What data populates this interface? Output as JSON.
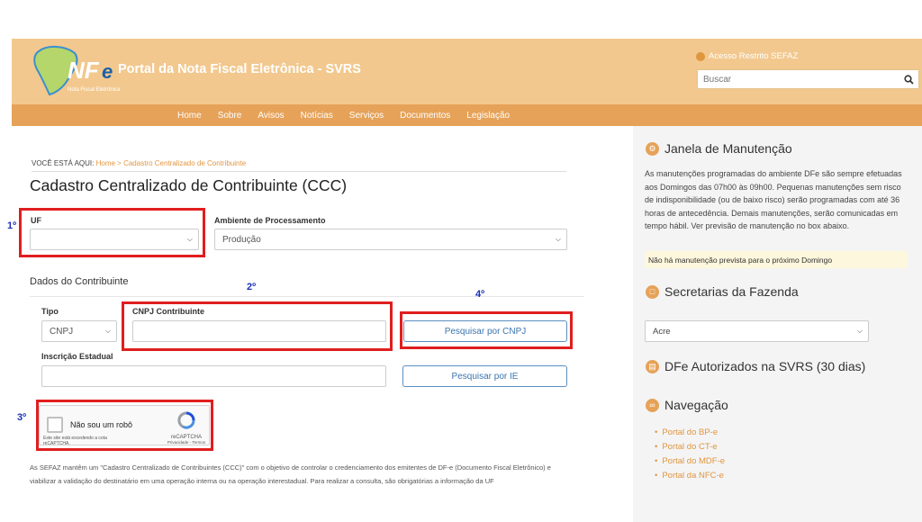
{
  "header": {
    "logo_text": "NF-e",
    "logo_sub": "Nota Fiscal Eletrônica",
    "portal_title": "Portal da Nota Fiscal Eletrônica - SVRS",
    "restricted_access": "Acesso Restrito SEFAZ",
    "search_placeholder": "Buscar"
  },
  "nav": [
    "Home",
    "Sobre",
    "Avisos",
    "Notícias",
    "Serviços",
    "Documentos",
    "Legislação"
  ],
  "breadcrumb": {
    "prefix": "VOCÊ ESTÁ AQUI:",
    "home": "Home",
    "separator": ">",
    "current": "Cadastro Centralizado de Contribuinte"
  },
  "page_title": "Cadastro Centralizado de Contribuinte (CCC)",
  "form": {
    "uf_label": "UF",
    "uf_value": "",
    "ambiente_label": "Ambiente de Processamento",
    "ambiente_value": "Produção",
    "section_title": "Dados do Contribuinte",
    "tipo_label": "Tipo",
    "tipo_value": "CNPJ",
    "cnpj_label": "CNPJ Contribuinte",
    "cnpj_value": "",
    "ie_label": "Inscrição Estadual",
    "ie_value": "",
    "search_cnpj_button": "Pesquisar por CNPJ",
    "search_ie_button": "Pesquisar por IE"
  },
  "captcha": {
    "label": "Não sou um robô",
    "brand": "reCAPTCHA",
    "links": "Privacidade - Termos",
    "notice": "Este site está excedendo a cota reCAPTCHA."
  },
  "description": "As SEFAZ mantêm um \"Cadastro Centralizado de Contribuintes (CCC)\" com o objetivo de controlar o credenciamento dos emitentes de DF-e (Documento Fiscal Eletrônico) e viabilizar a validação do destinatário em uma operação interna ou na operação interestadual. Para realizar a consulta, são obrigatórias a informação da UF",
  "steps": {
    "s1": "1º",
    "s2": "2º",
    "s3": "3º",
    "s4": "4º"
  },
  "sidebar": {
    "maintenance_title": "Janela de Manutenção",
    "maintenance_text": "As manutenções programadas do ambiente DFe são sempre efetuadas aos Domingos das 07h00 às 09h00. Pequenas manutenções sem risco de indisponibilidade (ou de baixo risco) serão programadas com até 36 horas de antecedência. Demais manutenções, serão comunicadas em tempo hábil. Ver previsão de manutenção no box abaixo.",
    "maintenance_notice": "Não há manutenção prevista para o próximo Domingo",
    "secretarias_title": "Secretarias da Fazenda",
    "secretarias_value": "Acre",
    "dfe_title": "DFe Autorizados na SVRS (30 dias)",
    "nav_title": "Navegação",
    "nav_links": [
      "Portal do BP-e",
      "Portal do CT-e",
      "Portal do MDF-e",
      "Portal da NFC-e"
    ]
  },
  "colors": {
    "header_bg": "#f2c88e",
    "navbar_bg": "#e6a258",
    "accent": "#e09640",
    "highlight_box": "#e01e1e",
    "step_label": "#1c2fb8",
    "button_text": "#3b75b0"
  }
}
